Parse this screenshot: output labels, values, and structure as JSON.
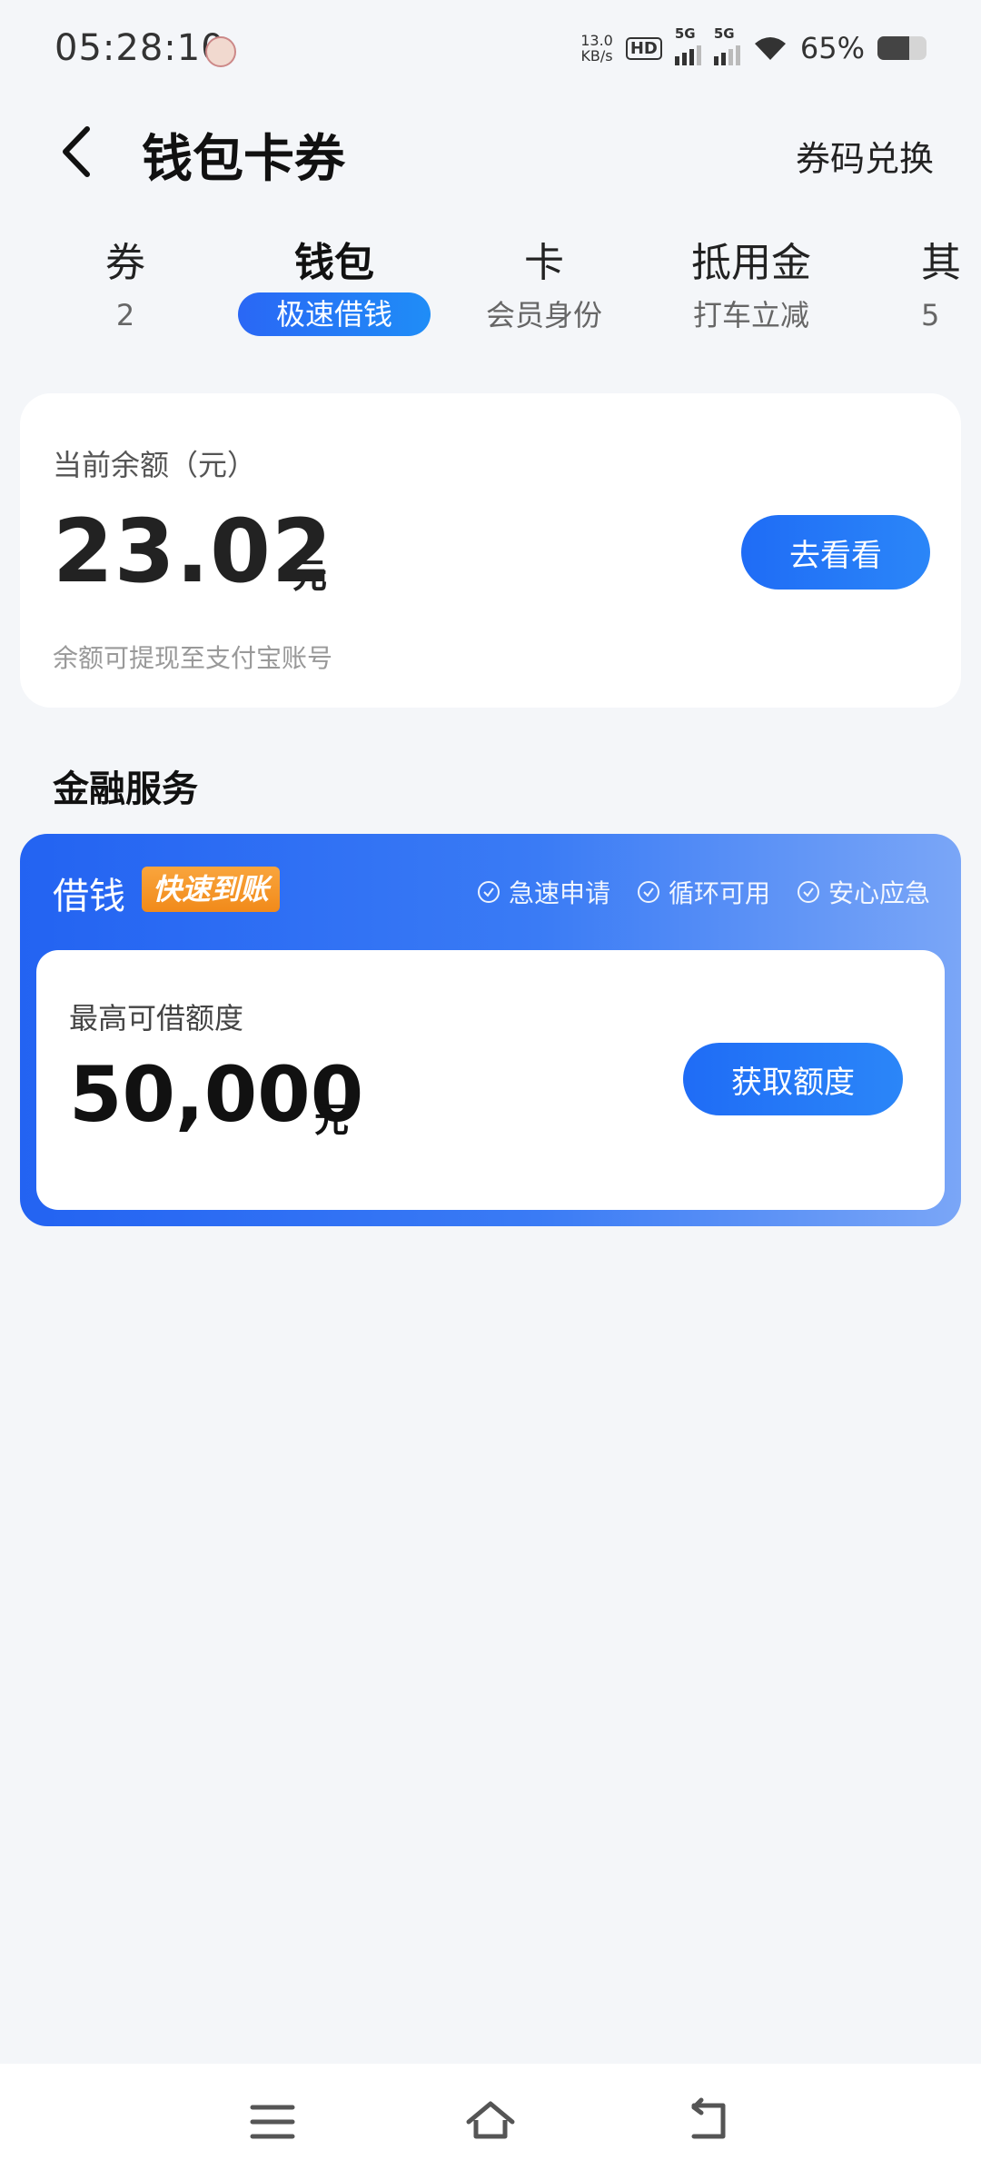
{
  "status_bar": {
    "time": "05:28:10",
    "net_speed_value": "13.0",
    "net_speed_unit": "KB/s",
    "hd_label": "HD",
    "signal1": "5G",
    "signal2": "5G",
    "battery_percent": "65%",
    "battery_level": 0.65
  },
  "header": {
    "title": "钱包卡券",
    "action": "券码兑换"
  },
  "tabs": [
    {
      "title": "券",
      "sub": "2"
    },
    {
      "title": "钱包",
      "sub": "极速借钱",
      "active": true
    },
    {
      "title": "卡",
      "sub": "会员身份"
    },
    {
      "title": "抵用金",
      "sub": "打车立减"
    },
    {
      "title": "其",
      "sub": "5"
    }
  ],
  "balance": {
    "label": "当前余额（元）",
    "amount": "23.02",
    "unit": "元",
    "button": "去看看",
    "note": "余额可提现至支付宝账号"
  },
  "section": {
    "title": "金融服务"
  },
  "loan": {
    "title": "借钱",
    "badge": "快速到账",
    "features": [
      "急速申请",
      "循环可用",
      "安心应急"
    ],
    "limit_label": "最高可借额度",
    "limit_amount": "50,000",
    "limit_unit": "元",
    "button": "获取额度"
  },
  "colors": {
    "accent": "#1f6cf6",
    "background": "#f4f6f9",
    "badge_orange": "#f39020"
  },
  "nav_icons": [
    "menu-icon",
    "home-icon",
    "back-icon"
  ]
}
